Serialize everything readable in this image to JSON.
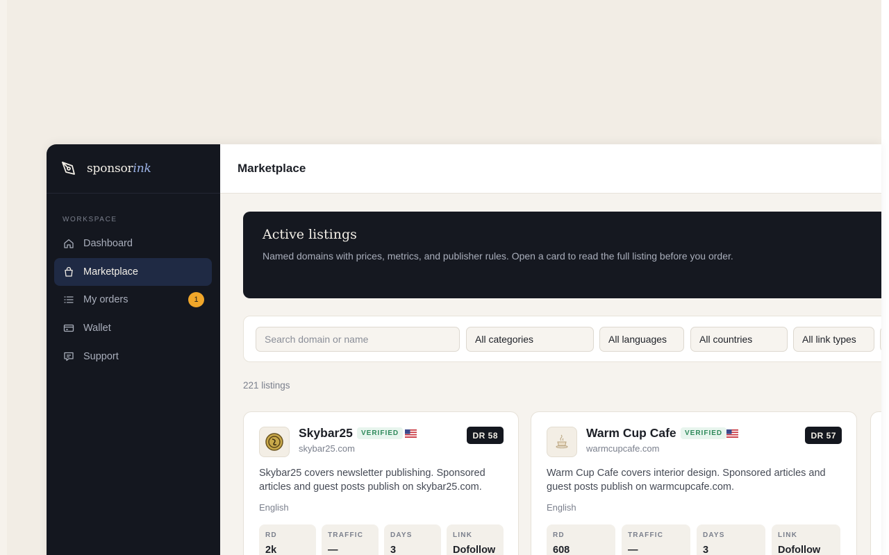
{
  "brand": {
    "name_plain": "sponsor",
    "name_italic": "ink"
  },
  "sidebar": {
    "section_label": "WORKSPACE",
    "items": [
      {
        "label": "Dashboard",
        "icon": "home-icon",
        "active": false
      },
      {
        "label": "Marketplace",
        "icon": "shopping-bag-icon",
        "active": true
      },
      {
        "label": "My orders",
        "icon": "list-icon",
        "active": false,
        "badge": "1"
      },
      {
        "label": "Wallet",
        "icon": "wallet-icon",
        "active": false
      },
      {
        "label": "Support",
        "icon": "support-chat-icon",
        "active": false
      }
    ]
  },
  "header": {
    "title": "Marketplace"
  },
  "hero": {
    "title": "Active listings",
    "description": "Named domains with prices, metrics, and publisher rules. Open a card to read the full listing before you order."
  },
  "filters": {
    "search_placeholder": "Search domain or name",
    "category": "All categories",
    "language": "All languages",
    "country": "All countries",
    "link_type": "All link types"
  },
  "listing_count": "221 listings",
  "cards": [
    {
      "name": "Skybar25",
      "verified": "VERIFIED",
      "flag": "us-flag-icon",
      "domain": "skybar25.com",
      "dr": "DR 58",
      "description_line1": "Skybar25 covers newsletter publishing. Sponsored",
      "description_line2": "articles and guest posts publish on skybar25.com.",
      "language": "English",
      "metrics": [
        {
          "label": "RD",
          "value": "2k"
        },
        {
          "label": "TRAFFIC",
          "value": "—"
        },
        {
          "label": "DAYS",
          "value": "3"
        },
        {
          "label": "LINK",
          "value": "Dofollow"
        }
      ]
    },
    {
      "name": "Warm Cup Cafe",
      "verified": "VERIFIED",
      "flag": "us-flag-icon",
      "domain": "warmcupcafe.com",
      "dr": "DR 57",
      "description_line1": "Warm Cup Cafe covers interior design. Sponsored articles and",
      "description_line2": "guest posts publish on warmcupcafe.com.",
      "language": "English",
      "metrics": [
        {
          "label": "RD",
          "value": "608"
        },
        {
          "label": "TRAFFIC",
          "value": "—"
        },
        {
          "label": "DAYS",
          "value": "3"
        },
        {
          "label": "LINK",
          "value": "Dofollow"
        }
      ]
    }
  ]
}
